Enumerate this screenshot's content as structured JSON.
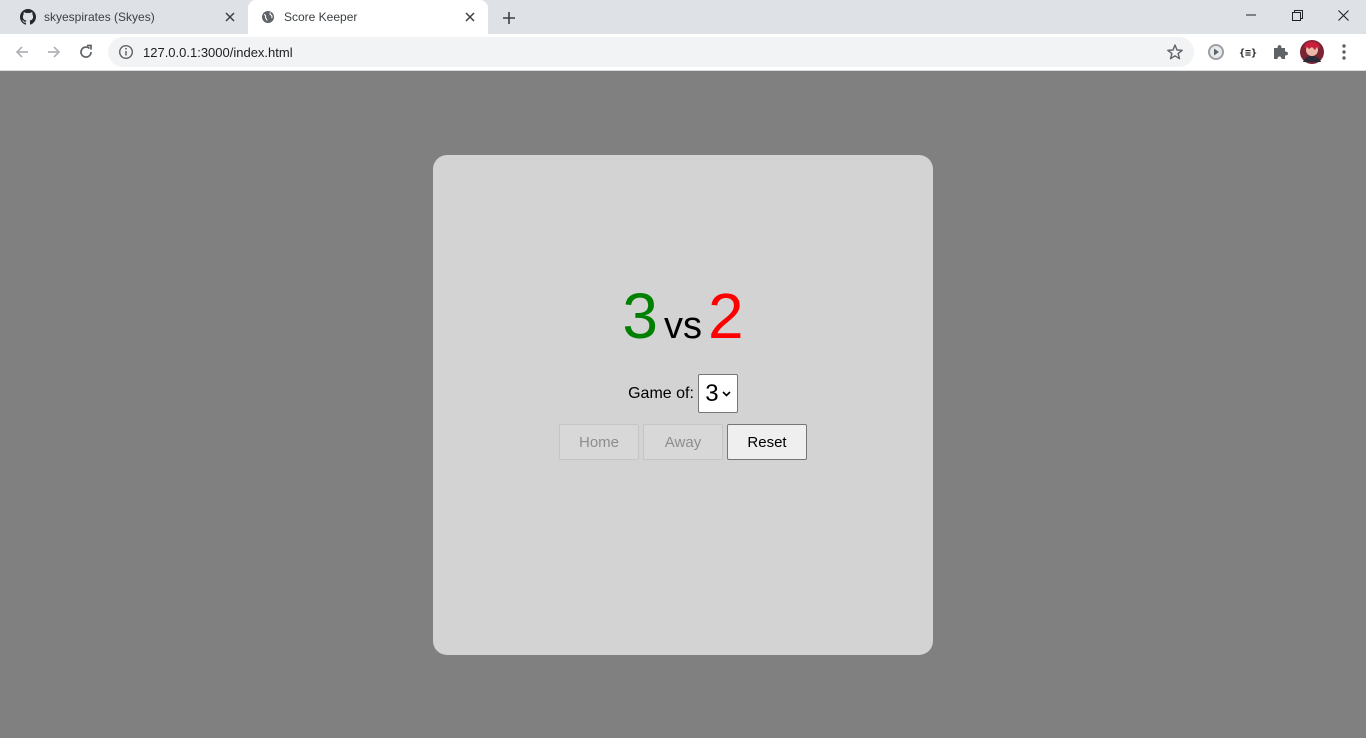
{
  "browser": {
    "tabs": [
      {
        "title": "skyespirates (Skyes)",
        "favicon": "github-icon",
        "active": false
      },
      {
        "title": "Score Keeper",
        "favicon": "globe-icon",
        "active": true
      }
    ],
    "url": "127.0.0.1:3000/index.html"
  },
  "scorekeeper": {
    "home_score": "3",
    "vs_label": "vs",
    "away_score": "2",
    "game_of_label": "Game of:",
    "game_of_value": "3",
    "buttons": {
      "home": "Home",
      "away": "Away",
      "reset": "Reset"
    }
  },
  "colors": {
    "home": "#008000",
    "away": "#ff0000",
    "page_bg": "#808080",
    "card_bg": "#d3d3d3"
  }
}
